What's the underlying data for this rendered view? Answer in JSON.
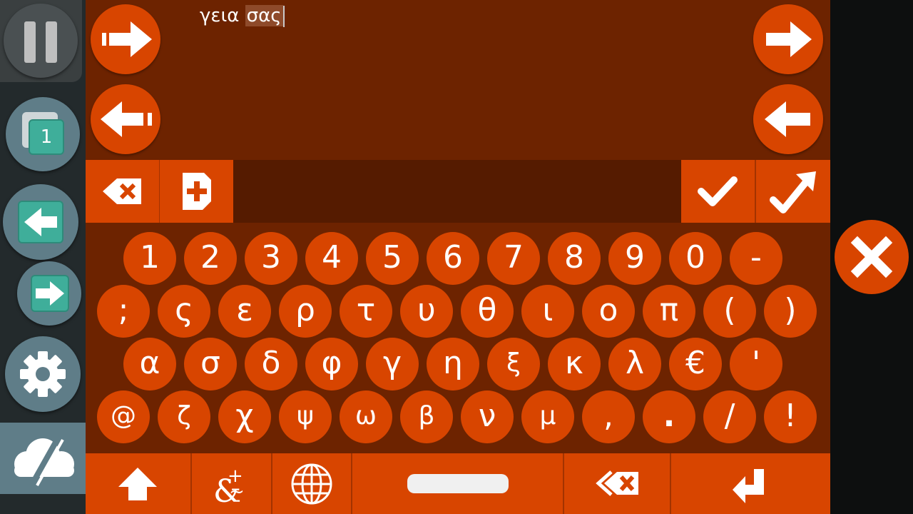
{
  "sidebar": {
    "pause_icon": "pause-icon",
    "windows_count": "1",
    "back_icon": "arrow-left-icon",
    "forward_icon": "arrow-right-icon",
    "settings_icon": "gear-icon",
    "cloud_icon": "cloud-off-icon"
  },
  "compose": {
    "text_before": "γεια ",
    "selected_text": "σας"
  },
  "nav": {
    "left_next_icon": "arrow-right-icon",
    "left_prev_icon": "arrow-left-icon",
    "right_next_icon": "arrow-right-icon",
    "right_prev_icon": "arrow-left-icon"
  },
  "toolbar": {
    "backspace_icon": "backspace-icon",
    "add_word_icon": "add-document-icon",
    "accept_icon": "check-icon",
    "accept_up_icon": "check-arrow-icon"
  },
  "keyboard": {
    "rows": [
      [
        "1",
        "2",
        "3",
        "4",
        "5",
        "6",
        "7",
        "8",
        "9",
        "0",
        "-"
      ],
      [
        ";",
        "ς",
        "ε",
        "ρ",
        "τ",
        "υ",
        "θ",
        "ι",
        "ο",
        "π",
        "(",
        ")"
      ],
      [
        "α",
        "σ",
        "δ",
        "φ",
        "γ",
        "η",
        "ξ",
        "κ",
        "λ",
        "€",
        "'"
      ],
      [
        "@",
        "ζ",
        "χ",
        "ψ",
        "ω",
        "β",
        "ν",
        "μ",
        ",",
        ".",
        "/",
        "!"
      ]
    ]
  },
  "bottom_bar": {
    "shift_icon": "shift-up-icon",
    "symbols_icon": "symbols-icon",
    "language_icon": "globe-icon",
    "space_icon": "space-bar-icon",
    "delete_word_icon": "delete-word-icon",
    "enter_icon": "enter-icon"
  },
  "close_icon": "close-icon",
  "colors": {
    "accent": "#d84500",
    "panel": "#6d2300",
    "toolbar_bg": "#551b00",
    "sidebar_bg": "#232a2c",
    "sidebar_button": "#5f7d88",
    "teal": "#3fae9a"
  }
}
